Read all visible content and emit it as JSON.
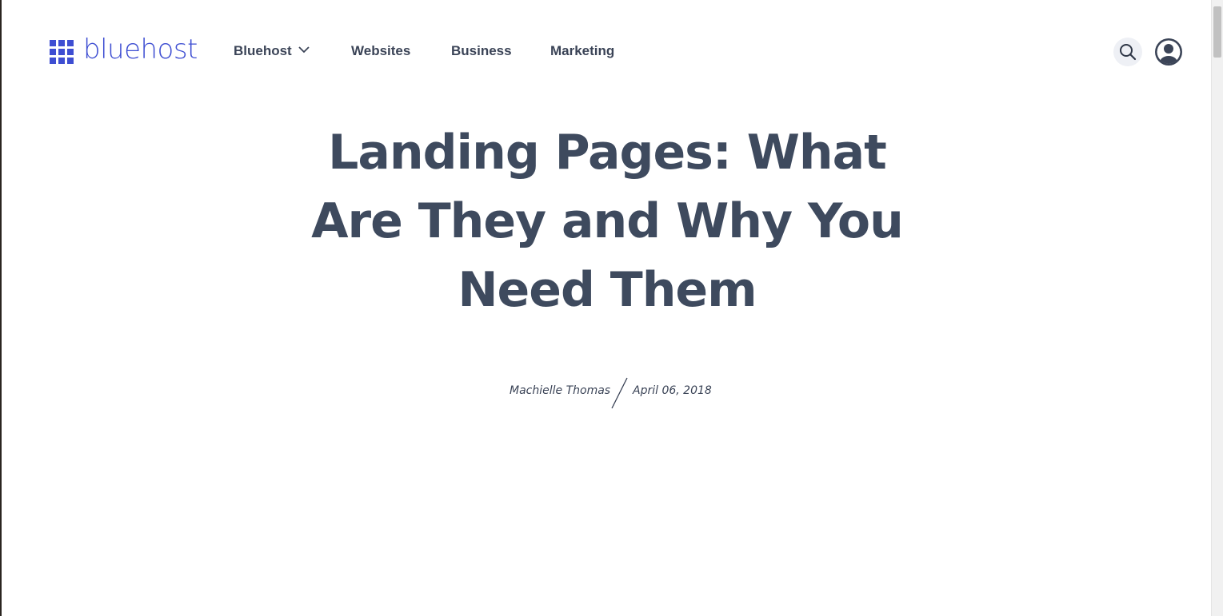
{
  "brand": {
    "name": "bluehost",
    "accent": "#3e4ed2"
  },
  "nav": {
    "items": [
      {
        "label": "Bluehost",
        "has_dropdown": true
      },
      {
        "label": "Websites",
        "has_dropdown": false
      },
      {
        "label": "Business",
        "has_dropdown": false
      },
      {
        "label": "Marketing",
        "has_dropdown": false
      }
    ]
  },
  "header_actions": {
    "search_icon": "search-icon",
    "account_icon": "user-icon"
  },
  "article": {
    "title": "Landing Pages: What Are They and Why You Need Them",
    "author": "Machielle Thomas",
    "date": "April 06, 2018"
  },
  "colors": {
    "text": "#3b4457",
    "heading": "#3e4a5e",
    "search_bg": "#eef0f5"
  }
}
